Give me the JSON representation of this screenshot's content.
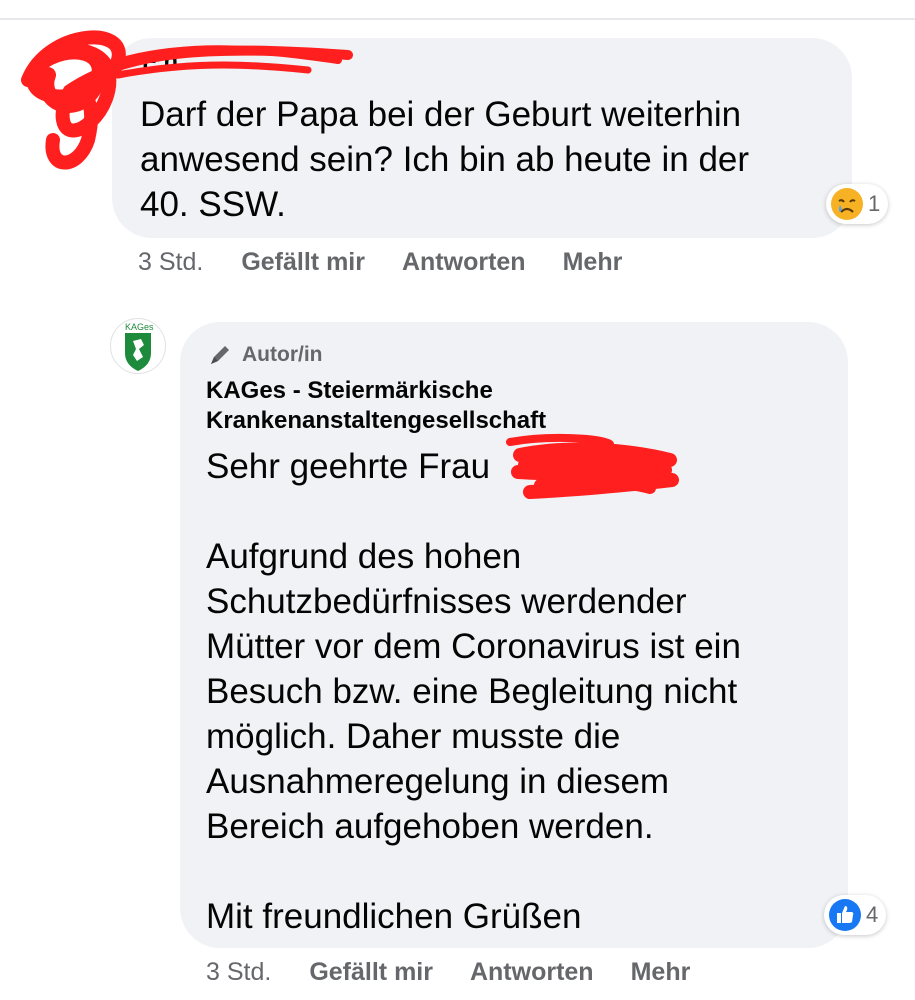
{
  "comments": [
    {
      "author": "F                   n",
      "text": "Darf der Papa bei der Geburt weiterhin\nanwesend sein? Ich bin ab heute in der\n40. SSW.",
      "time": "3 Std.",
      "like_label": "Gefällt mir",
      "reply_label": "Antworten",
      "more_label": "Mehr",
      "reaction": {
        "icon": "sad-face-icon",
        "count": "1",
        "color": "#f7b125"
      }
    },
    {
      "author_badge": "Autor/in",
      "author": "KAGes - Steiermärkische Krankenanstaltengesellschaft",
      "avatar_label": "KAGes",
      "greeting": "Sehr geehrte Frau",
      "text": "\nAufgrund des hohen\nSchutzbedürfnisses werdender\nMütter vor dem Coronavirus ist ein\nBesuch bzw. eine Begleitung nicht\nmöglich. Daher musste die\nAusnahmeregelung in diesem\nBereich aufgehoben werden.\n\nMit freundlichen Grüßen",
      "time": "3 Std.",
      "like_label": "Gefällt mir",
      "reply_label": "Antworten",
      "more_label": "Mehr",
      "reaction": {
        "icon": "thumbs-up-icon",
        "count": "4",
        "color": "#1877f2"
      }
    }
  ],
  "colors": {
    "bubble": "#f0f2f5",
    "text": "#050505",
    "secondary": "#65676b",
    "redaction": "#ff1f1f",
    "kages_green": "#1e8a3c"
  }
}
